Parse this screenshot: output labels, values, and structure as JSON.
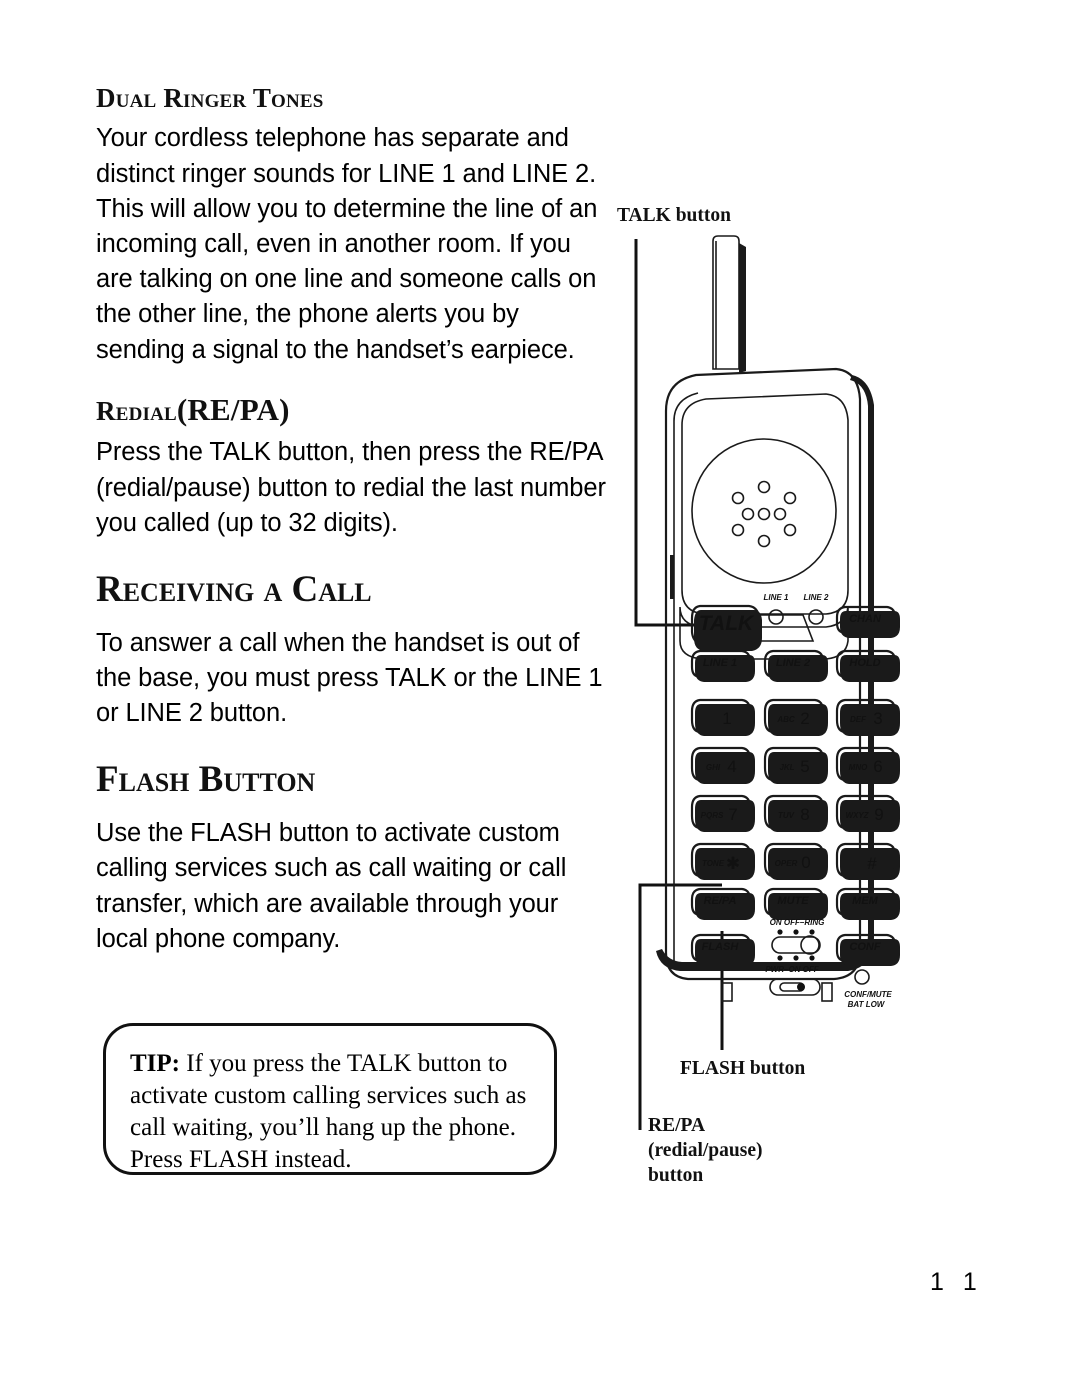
{
  "page": {
    "number": "1 1"
  },
  "sections": [
    {
      "id": "dual-ringer-tones",
      "heading": "Dual Ringer Tones",
      "body": "Your cordless telephone has separate and distinct ringer sounds for LINE 1 and LINE 2. This will allow you to determine the line of an incoming call, even in another room. If you are talking on one line and someone calls on the other line, the phone alerts you by sending a signal to the handset’s earpiece."
    },
    {
      "id": "redial-repa",
      "heading_small": "Redial",
      "heading_large": "(RE/PA)",
      "body": "Press the TALK button, then press the RE/PA (redial/pause) button to redial the last number you called (up to 32 digits)."
    },
    {
      "id": "receiving-a-call",
      "heading": "Receiving a Call",
      "body": "To answer a call when the handset is out of the base, you must press TALK or the LINE 1 or LINE 2 button."
    },
    {
      "id": "flash-button",
      "heading": "Flash Button",
      "body": "Use the FLASH button to activate custom calling services such as call waiting or call transfer, which are available through your local phone company."
    }
  ],
  "tip": {
    "label": "TIP:",
    "text": " If you press the TALK button to activate custom calling services such as call waiting, you’ll hang up the phone. Press FLASH instead."
  },
  "diagram": {
    "callouts": {
      "talk": "TALK button",
      "flash": "FLASH button",
      "repa_line1": "RE/PA",
      "repa_line2": "(redial/pause)",
      "repa_line3": "button"
    },
    "indicators": {
      "line1": "LINE 1",
      "line2": "LINE 2"
    },
    "switch_labels": {
      "ringer_top": "ON  OFF–RING",
      "power_bottom": "PWR–ON  OFF",
      "led_line1": "CONF/MUTE",
      "led_line2": "BAT LOW"
    },
    "keys": {
      "talk": "TALK",
      "chan": "CHAN",
      "line1": "LINE 1",
      "line2": "LINE 2",
      "hold": "HOLD",
      "k1_letters": "",
      "k1_digit": "1",
      "k2_letters": "ABC",
      "k2_digit": "2",
      "k3_letters": "DEF",
      "k3_digit": "3",
      "k4_letters": "GHI",
      "k4_digit": "4",
      "k5_letters": "JKL",
      "k5_digit": "5",
      "k6_letters": "MNO",
      "k6_digit": "6",
      "k7_letters": "PQRS",
      "k7_digit": "7",
      "k8_letters": "TUV",
      "k8_digit": "8",
      "k9_letters": "WXYZ",
      "k9_digit": "9",
      "kstar_letters": "TONE",
      "kstar_digit": "✱",
      "k0_letters": "OPER",
      "k0_digit": "0",
      "khash_digit": "#",
      "repa": "RE/PA",
      "mute": "MUTE",
      "mem": "MEM",
      "flash": "FLASH",
      "conf": "CONF"
    }
  },
  "colors": {
    "ink": "#111111",
    "paper": "#ffffff"
  }
}
